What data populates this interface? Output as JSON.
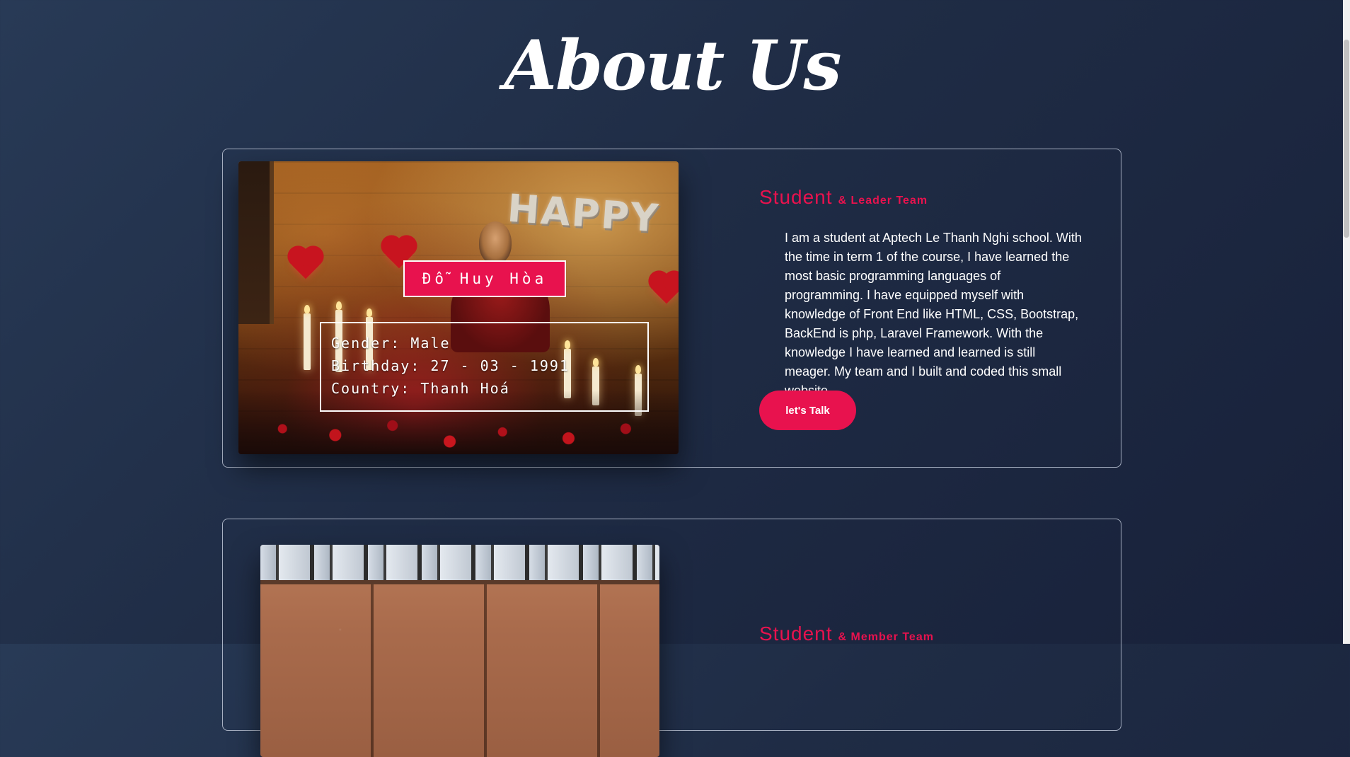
{
  "page": {
    "title": "About Us"
  },
  "members": [
    {
      "name": "Đỗ Huy Hòa",
      "info": {
        "gender": "Gender: Male",
        "birthday": "Birthday: 27 - 03 - 1991",
        "country": "Country: Thanh Hoá"
      },
      "role": "Student",
      "role_detail": "& Leader Team",
      "description": "I am a student at Aptech Le Thanh Nghi school. With the time in term 1 of the course, I have learned the most basic programming languages of programming. I have equipped myself with knowledge of Front End like HTML, CSS, Bootstrap, BackEnd is php, Laravel Framework. With the knowledge I have learned and learned is still meager. My team and I built and coded this small website.",
      "cta_label": "let's Talk"
    },
    {
      "role": "Student",
      "role_detail": "& Member Team"
    }
  ],
  "colors": {
    "accent": "#e8124e",
    "background_start": "#283a56",
    "background_end": "#18213a",
    "card_border": "#a7b0c2"
  }
}
